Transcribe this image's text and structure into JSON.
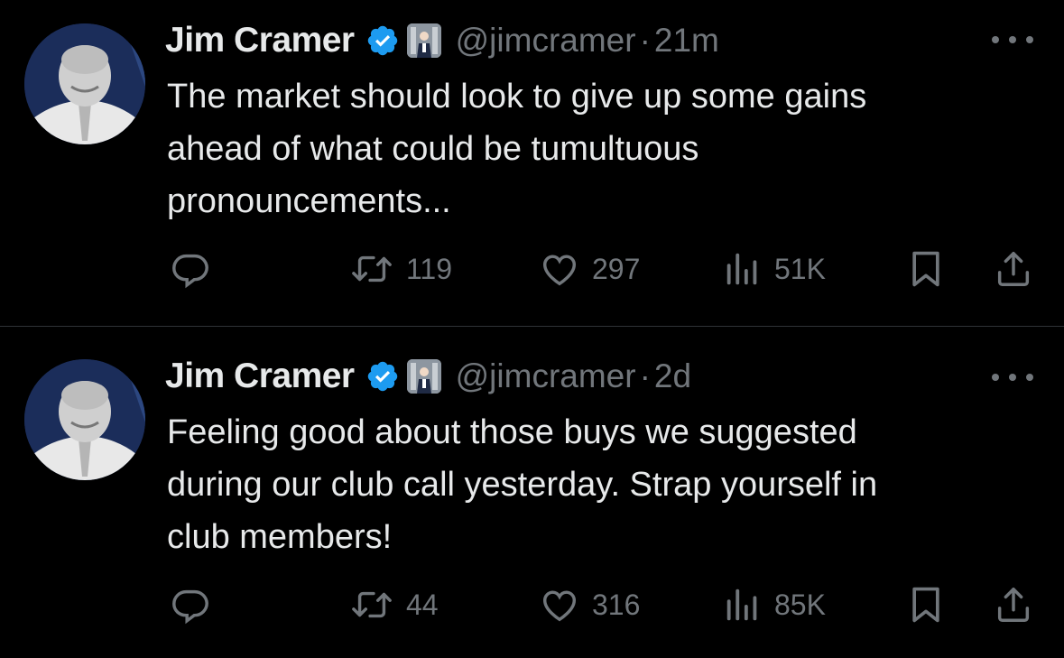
{
  "colors": {
    "background": "#000000",
    "text": "#e7e9ea",
    "muted": "#71767b",
    "verified": "#1d9bf0",
    "divider": "#2f3336"
  },
  "tweets": [
    {
      "name": "Jim Cramer",
      "handle": "@jimcramer",
      "separator": "·",
      "time": "21m",
      "text": "The market should look to give up some gains\nahead of what could be tumultuous\npronouncements...",
      "reply_count": "",
      "retweet_count": "119",
      "like_count": "297",
      "view_count": "51K",
      "icons": [
        "reply-icon",
        "retweet-icon",
        "like-icon",
        "views-icon",
        "bookmark-icon",
        "share-icon",
        "more-icon"
      ]
    },
    {
      "name": "Jim Cramer",
      "handle": "@jimcramer",
      "separator": "·",
      "time": "2d",
      "text": "Feeling good about those buys we suggested\nduring our club call yesterday. Strap yourself in\nclub members!",
      "reply_count": "",
      "retweet_count": "44",
      "like_count": "316",
      "view_count": "85K",
      "icons": [
        "reply-icon",
        "retweet-icon",
        "like-icon",
        "views-icon",
        "bookmark-icon",
        "share-icon",
        "more-icon"
      ]
    }
  ]
}
